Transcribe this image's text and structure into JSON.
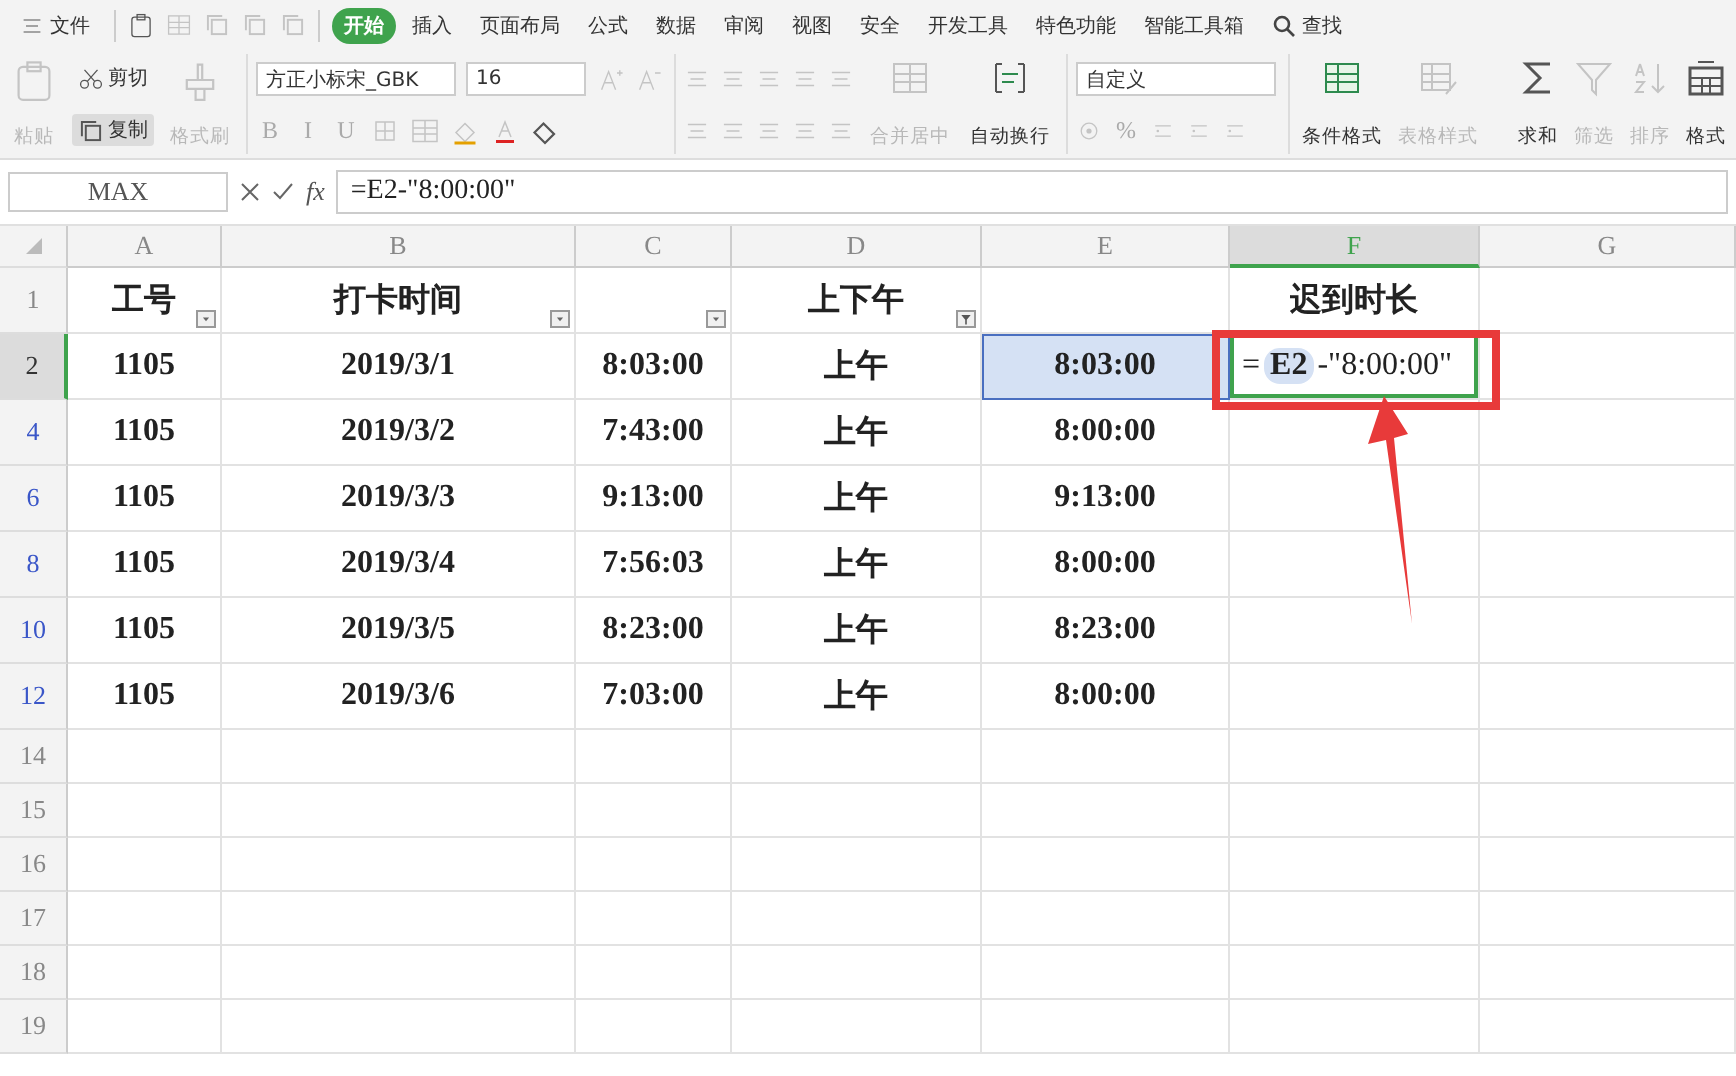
{
  "menu_bar": {
    "file_menu": "文件",
    "tabs": [
      {
        "label": "开始",
        "selected": true
      },
      {
        "label": "插入",
        "selected": false
      },
      {
        "label": "页面布局",
        "selected": false
      },
      {
        "label": "公式",
        "selected": false
      },
      {
        "label": "数据",
        "selected": false
      },
      {
        "label": "审阅",
        "selected": false
      },
      {
        "label": "视图",
        "selected": false
      },
      {
        "label": "安全",
        "selected": false
      },
      {
        "label": "开发工具",
        "selected": false
      },
      {
        "label": "特色功能",
        "selected": false
      },
      {
        "label": "智能工具箱",
        "selected": false
      }
    ],
    "search": "查找"
  },
  "ribbon": {
    "paste": {
      "label": "粘贴",
      "disabled": true
    },
    "cut": "剪切",
    "copy": {
      "label": "复制",
      "pressed": true
    },
    "format_painter": {
      "label": "格式刷",
      "disabled": true
    },
    "font_name": "方正小标宋_GBK",
    "font_size": "16",
    "style_buttons": [
      "B",
      "I",
      "U"
    ],
    "merge": {
      "label": "合并居中",
      "disabled": true
    },
    "wrap": {
      "label": "自动换行",
      "disabled": false
    },
    "number_format": "自定义",
    "percent": "%",
    "big_buttons": [
      {
        "kind": "conditional",
        "label": "条件格式",
        "disabled": false
      },
      {
        "kind": "table-style",
        "label": "表格样式",
        "disabled": true
      },
      {
        "kind": "sum",
        "label": "求和",
        "disabled": false
      },
      {
        "kind": "filter",
        "label": "筛选",
        "disabled": true
      },
      {
        "kind": "sort",
        "label": "排序",
        "disabled": true
      },
      {
        "kind": "format",
        "label": "格式",
        "disabled": false
      }
    ]
  },
  "formula_bar": {
    "name_box": "MAX",
    "fx": "fx",
    "formula": "=E2-\"8:00:00\""
  },
  "sheet": {
    "columns": [
      {
        "label": "A",
        "selected": false
      },
      {
        "label": "B",
        "selected": false
      },
      {
        "label": "C",
        "selected": false
      },
      {
        "label": "D",
        "selected": false
      },
      {
        "label": "E",
        "selected": false
      },
      {
        "label": "F",
        "selected": true
      },
      {
        "label": "G",
        "selected": false
      }
    ],
    "header_row": {
      "number": "1",
      "cells": [
        {
          "text": "工号",
          "filter_button": true,
          "filter_applied": false
        },
        {
          "text": "打卡时间",
          "filter_button": true,
          "filter_applied": false
        },
        {
          "filter_button": true,
          "filter_applied": false
        },
        {
          "text": "上下午",
          "filter_button": true,
          "filter_applied": true
        },
        {},
        {
          "text": "迟到时长"
        },
        {}
      ]
    },
    "rows": [
      {
        "number": "2",
        "selected": true,
        "cells": [
          {
            "kind": "text",
            "text": "1105",
            "referenced": false
          },
          {
            "kind": "text",
            "text": "2019/3/1",
            "referenced": false
          },
          {
            "kind": "text",
            "text": "8:03:00",
            "referenced": false
          },
          {
            "kind": "text",
            "text": "上午",
            "referenced": false
          },
          {
            "kind": "text",
            "text": "8:03:00",
            "referenced": true
          },
          {
            "kind": "editing",
            "prefix": "=",
            "ref": "E2",
            "suffix": "-\"8:00:00\""
          }
        ]
      },
      {
        "number": "4",
        "selected": false,
        "cells": [
          {
            "kind": "text",
            "text": "1105",
            "referenced": false
          },
          {
            "kind": "text",
            "text": "2019/3/2",
            "referenced": false
          },
          {
            "kind": "text",
            "text": "7:43:00",
            "referenced": false
          },
          {
            "kind": "text",
            "text": "上午",
            "referenced": false
          },
          {
            "kind": "text",
            "text": "8:00:00",
            "referenced": false
          }
        ]
      },
      {
        "number": "6",
        "selected": false,
        "cells": [
          {
            "kind": "text",
            "text": "1105",
            "referenced": false
          },
          {
            "kind": "text",
            "text": "2019/3/3",
            "referenced": false
          },
          {
            "kind": "text",
            "text": "9:13:00",
            "referenced": false
          },
          {
            "kind": "text",
            "text": "上午",
            "referenced": false
          },
          {
            "kind": "text",
            "text": "9:13:00",
            "referenced": false
          }
        ]
      },
      {
        "number": "8",
        "selected": false,
        "cells": [
          {
            "kind": "text",
            "text": "1105",
            "referenced": false
          },
          {
            "kind": "text",
            "text": "2019/3/4",
            "referenced": false
          },
          {
            "kind": "text",
            "text": "7:56:03",
            "referenced": false
          },
          {
            "kind": "text",
            "text": "上午",
            "referenced": false
          },
          {
            "kind": "text",
            "text": "8:00:00",
            "referenced": false
          }
        ]
      },
      {
        "number": "10",
        "selected": false,
        "cells": [
          {
            "kind": "text",
            "text": "1105",
            "referenced": false
          },
          {
            "kind": "text",
            "text": "2019/3/5",
            "referenced": false
          },
          {
            "kind": "text",
            "text": "8:23:00",
            "referenced": false
          },
          {
            "kind": "text",
            "text": "上午",
            "referenced": false
          },
          {
            "kind": "text",
            "text": "8:23:00",
            "referenced": false
          }
        ]
      },
      {
        "number": "12",
        "selected": false,
        "cells": [
          {
            "kind": "text",
            "text": "1105",
            "referenced": false
          },
          {
            "kind": "text",
            "text": "2019/3/6",
            "referenced": false
          },
          {
            "kind": "text",
            "text": "7:03:00",
            "referenced": false
          },
          {
            "kind": "text",
            "text": "上午",
            "referenced": false
          },
          {
            "kind": "text",
            "text": "8:00:00",
            "referenced": false
          }
        ]
      }
    ],
    "empty_rows": [
      "14",
      "15",
      "16",
      "17",
      "18",
      "19"
    ]
  }
}
